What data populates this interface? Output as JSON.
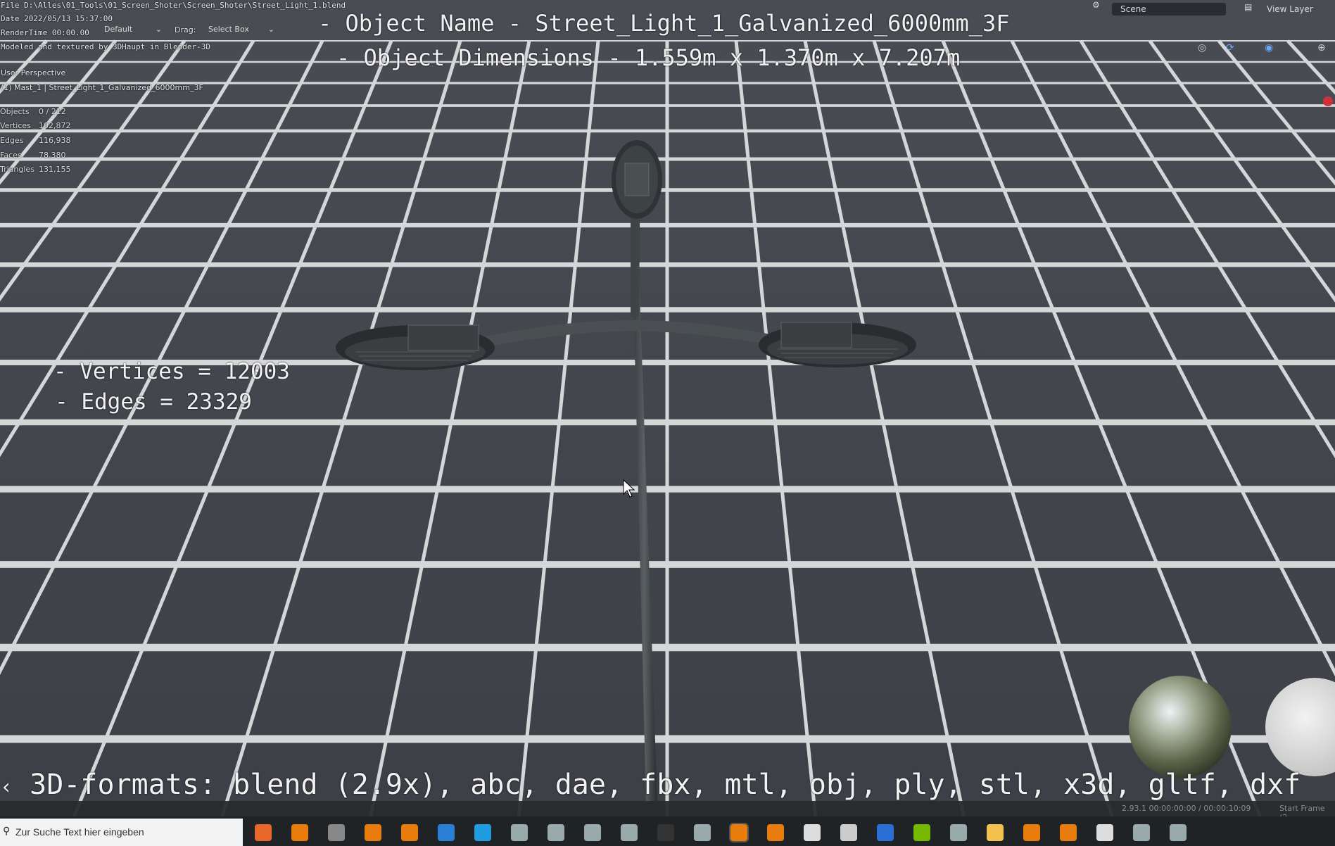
{
  "file_info": {
    "file_line": "File D:\\Alles\\01_Tools\\01_Screen_Shoter\\Screen_Shoter\\Street_Light_1.blend",
    "date_line": "Date 2022/05/13 15:37:00",
    "render_time_line": "RenderTime 00:00.00",
    "modeled_line": "Modeled and textured by 3DHaupt in Blender-3D"
  },
  "header": {
    "default_select": "Default",
    "drag_label": "Drag:",
    "drag_value": "Select Box",
    "scene_label": "Scene",
    "view_layer_label": "View Layer"
  },
  "viewport_info": {
    "perspective": "User Perspective",
    "collection_line": "(1) Mast_1 | Street_Light_1_Galvanized_6000mm_3F"
  },
  "stats": [
    {
      "label": "Objects",
      "value": "0 / 212"
    },
    {
      "label": "Vertices",
      "value": "102,872"
    },
    {
      "label": "Edges",
      "value": "116,938"
    },
    {
      "label": "Faces",
      "value": "78,380"
    },
    {
      "label": "Triangles",
      "value": "131,155"
    }
  ],
  "overlay": {
    "object_name": "- Object Name - Street_Light_1_Galvanized_6000mm_3F",
    "object_dimensions": "- Object Dimensions -  1.559m x 1.370m x 7.207m",
    "vertices": "- Vertices = 12003",
    "edges": "- Edges = 23329",
    "formats": "3D-formats: blend (2.9x), abc, dae, fbx, mtl, obj, ply, stl, x3d, gltf, dxf"
  },
  "status_bar": {
    "version_time": "2.93.1  00:00:00:00 / 00:00:10:09",
    "start_frame": "Start Frame (2"
  },
  "taskbar": {
    "search_placeholder": "Zur Suche Text hier eingeben",
    "icons": [
      "firefox-icon",
      "blender-icon",
      "steam-icon",
      "blender-icon",
      "blender-icon",
      "mail-icon",
      "edge-icon",
      "app-icon",
      "app-icon",
      "app-icon",
      "app-icon",
      "terminal-icon",
      "app-icon",
      "blender-icon",
      "blender-icon",
      "panda-icon",
      "cube-icon",
      "calendar-icon",
      "nvidia-icon",
      "app-icon",
      "folder-icon",
      "blender-icon",
      "blender-icon",
      "settings-icon",
      "app-icon",
      "app-icon"
    ]
  },
  "colors": {
    "grid_tile": "#52545c",
    "grid_line": "#d7d8da",
    "background": "#3a3c44",
    "taskbar": "#1f2326"
  }
}
